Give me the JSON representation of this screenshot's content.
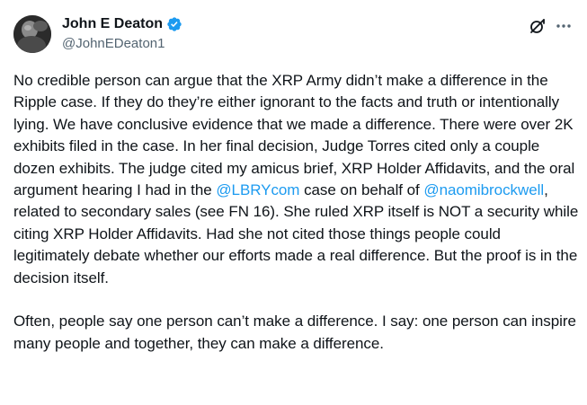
{
  "author": {
    "display_name": "John E Deaton",
    "handle": "@JohnEDeaton1",
    "verified": true
  },
  "icons": {
    "verified": "verified-badge-icon",
    "grok": "grok-icon",
    "more": "more-options-icon",
    "avatar": "profile-avatar"
  },
  "colors": {
    "text": "#0f1419",
    "secondary": "#536471",
    "link": "#1d9bf0"
  },
  "tweet": {
    "paragraph1": {
      "seg1": "No credible person can argue that the XRP Army didn’t make a difference in the Ripple case. If they do they’re either ignorant to the facts and truth or intentionally lying. We have conclusive evidence that we made a difference. There were over 2K exhibits filed in the case. In her final decision, Judge Torres cited only a couple dozen exhibits. The judge cited my amicus brief, XRP Holder Affidavits, and the oral argument hearing I had in the ",
      "mention1": "@LBRYcom",
      "seg2": " case on behalf of ",
      "mention2": "@naomibrockwell",
      "seg3": ", related to secondary sales (see FN 16). She ruled XRP itself is NOT a security while citing XRP Holder Affidavits. Had she not cited those things people could legitimately debate whether our efforts made a real difference. But the proof is in the decision itself."
    },
    "paragraph2": "Often, people say one person can’t make a difference. I say: one person can inspire many people and together, they can make a difference."
  }
}
